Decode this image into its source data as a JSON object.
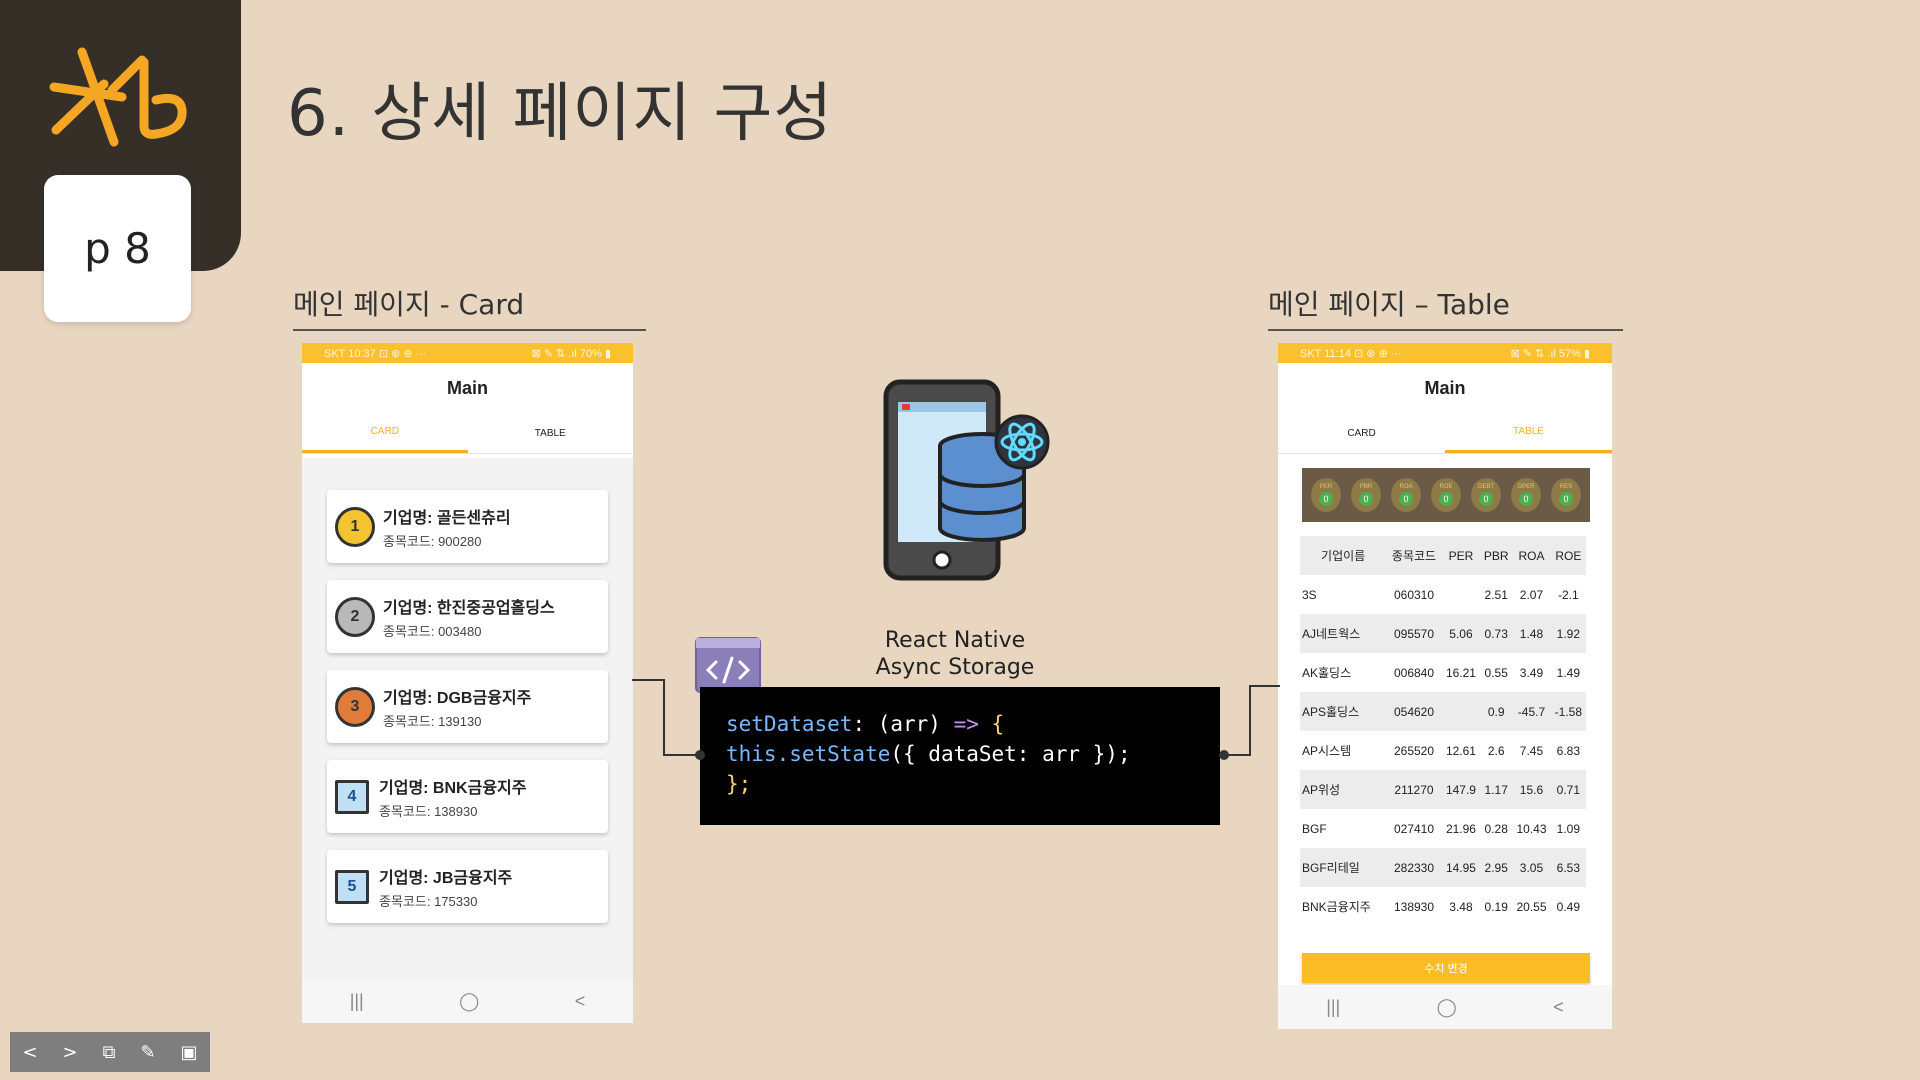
{
  "slide": {
    "title": "6. 상세 페이지 구성",
    "page_label": "p 8",
    "section_card_label": "메인 페이지  - Card",
    "section_table_label": "메인 페이지 – Table"
  },
  "card_phone": {
    "status_left": "SKT 10:37 ⊡ ⊛ ⊕ ···",
    "status_right": "⊠ ✎ ⇅ .ıl 70% ▮",
    "app_title": "Main",
    "tabs": [
      "CARD",
      "TABLE"
    ],
    "active_tab": "CARD",
    "cards": [
      {
        "rank": "1",
        "name": "기업명: 골든센츄리",
        "code": "종목코드: 900280"
      },
      {
        "rank": "2",
        "name": "기업명: 한진중공업홀딩스",
        "code": "종목코드: 003480"
      },
      {
        "rank": "3",
        "name": "기업명: DGB금융지주",
        "code": "종목코드: 139130"
      },
      {
        "rank": "4",
        "name": "기업명: BNK금융지주",
        "code": "종목코드: 138930"
      },
      {
        "rank": "5",
        "name": "기업명: JB금융지주",
        "code": "종목코드: 175330"
      }
    ],
    "nav": [
      "|||",
      "◯",
      "<"
    ]
  },
  "table_phone": {
    "status_left": "SKT 11:14 ⊡ ⊛ ⊕ ···",
    "status_right": "⊠ ✎ ⇅ .ıl 57% ▮",
    "app_title": "Main",
    "tabs": [
      "CARD",
      "TABLE"
    ],
    "active_tab": "TABLE",
    "indicators": [
      {
        "name": "PER",
        "value": "0"
      },
      {
        "name": "PBR",
        "value": "0"
      },
      {
        "name": "ROA",
        "value": "0"
      },
      {
        "name": "ROE",
        "value": "0"
      },
      {
        "name": "DEBT",
        "value": "0"
      },
      {
        "name": "OPER",
        "value": "0"
      },
      {
        "name": "RES",
        "value": "0"
      }
    ],
    "columns": [
      "기업이름",
      "종목코드",
      "PER",
      "PBR",
      "ROA",
      "ROE"
    ],
    "rows": [
      [
        "3S",
        "060310",
        "",
        "2.51",
        "2.07",
        "-2.1"
      ],
      [
        "AJ네트웍스",
        "095570",
        "5.06",
        "0.73",
        "1.48",
        "1.92"
      ],
      [
        "AK홀딩스",
        "006840",
        "16.21",
        "0.55",
        "3.49",
        "1.49"
      ],
      [
        "APS홀딩스",
        "054620",
        "",
        "0.9",
        "-45.7",
        "-1.58"
      ],
      [
        "AP시스템",
        "265520",
        "12.61",
        "2.6",
        "7.45",
        "6.83"
      ],
      [
        "AP위성",
        "211270",
        "147.9",
        "1.17",
        "15.6",
        "0.71"
      ],
      [
        "BGF",
        "027410",
        "21.96",
        "0.28",
        "10.43",
        "1.09"
      ],
      [
        "BGF리테일",
        "282330",
        "14.95",
        "2.95",
        "3.05",
        "6.53"
      ],
      [
        "BNK금융지주",
        "138930",
        "3.48",
        "0.19",
        "20.55",
        "0.49"
      ]
    ],
    "button_label": "수치 변경",
    "nav": [
      "|||",
      "◯",
      "<"
    ]
  },
  "center": {
    "async_label": "React Native Async Storage",
    "code_lines": [
      {
        "fn": "setDataset",
        "rest": ": (arr) ",
        "kw": "=>",
        "brace": " {"
      },
      {
        "fn": "this.setState",
        "rest": "",
        "kw": "",
        "brace": "({ dataSet: arr });"
      },
      {
        "fn": "",
        "rest": "",
        "kw": "",
        "brace": "};"
      }
    ]
  },
  "toolbar": [
    "<",
    ">",
    "⧉",
    "✎",
    "▣"
  ],
  "colors": {
    "background": "#e8d6c0",
    "corner": "#352f28",
    "accent_yellow": "#fbc02d",
    "logo_orange": "#f5a623"
  }
}
